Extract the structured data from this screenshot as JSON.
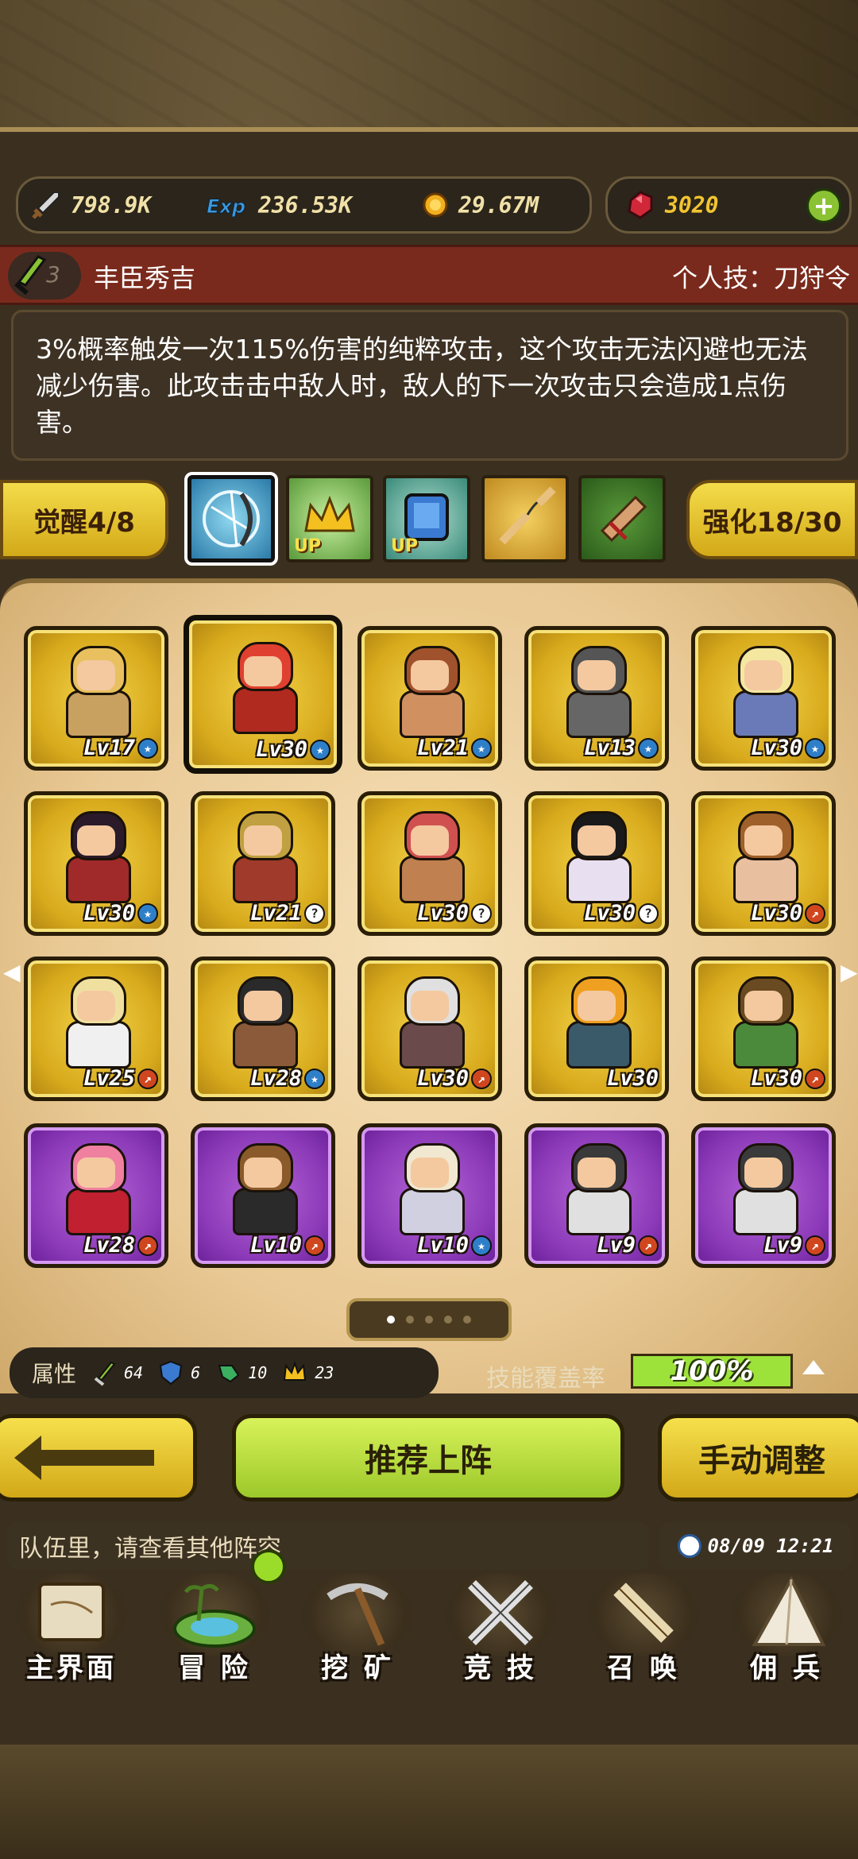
{
  "resources": {
    "attack": "798.9K",
    "exp": "236.53K",
    "gold": "29.67M",
    "gems": "3020"
  },
  "hero": {
    "level": "3",
    "name": "丰臣秀吉",
    "skill_label": "个人技：刀狩令",
    "description": "3%概率触发一次115%伤害的纯粹攻击，这个攻击无法闪避也无法减少伤害。此攻击击中敌人时，敌人的下一次攻击只会造成1点伤害。"
  },
  "tabs": {
    "awaken_label": "觉醒4/8",
    "enhance_label": "强化18/30",
    "up_label": "UP"
  },
  "roster": [
    {
      "level": "Lv17",
      "mark": "star",
      "rarity": "gold",
      "hair": "#e8c060",
      "outfit": "#c8a060"
    },
    {
      "level": "Lv30",
      "mark": "star",
      "rarity": "gold",
      "hair": "#e04030",
      "outfit": "#b02a20",
      "selected": true
    },
    {
      "level": "Lv21",
      "mark": "star",
      "rarity": "gold",
      "hair": "#a0522d",
      "outfit": "#d09060"
    },
    {
      "level": "Lv13",
      "mark": "star",
      "rarity": "gold",
      "hair": "#555555",
      "outfit": "#666666"
    },
    {
      "level": "Lv30",
      "mark": "star",
      "rarity": "gold",
      "hair": "#f4e8a0",
      "outfit": "#6a7ab8"
    },
    {
      "level": "Lv30",
      "mark": "star",
      "rarity": "gold",
      "hair": "#2a1a2a",
      "outfit": "#a02a2a"
    },
    {
      "level": "Lv21",
      "mark": "q",
      "rarity": "gold",
      "hair": "#c0a040",
      "outfit": "#a03a2a"
    },
    {
      "level": "Lv30",
      "mark": "q",
      "rarity": "gold",
      "hair": "#d05050",
      "outfit": "#c08050"
    },
    {
      "level": "Lv30",
      "mark": "q",
      "rarity": "gold",
      "hair": "#1a1a1a",
      "outfit": "#e8e0f0"
    },
    {
      "level": "Lv30",
      "mark": "bolt",
      "rarity": "gold",
      "hair": "#a0602a",
      "outfit": "#e8c0a0"
    },
    {
      "level": "Lv25",
      "mark": "bolt",
      "rarity": "gold",
      "hair": "#f0e0a0",
      "outfit": "#f0f0f0"
    },
    {
      "level": "Lv28",
      "mark": "star",
      "rarity": "gold",
      "hair": "#2a2a2a",
      "outfit": "#8a5a3a"
    },
    {
      "level": "Lv30",
      "mark": "bolt",
      "rarity": "gold",
      "hair": "#e0e0e0",
      "outfit": "#6a4a4a"
    },
    {
      "level": "Lv30",
      "mark": "",
      "rarity": "gold",
      "hair": "#f0a020",
      "outfit": "#3a5a6a"
    },
    {
      "level": "Lv30",
      "mark": "bolt",
      "rarity": "gold",
      "hair": "#6a4a20",
      "outfit": "#4a8a3a"
    },
    {
      "level": "Lv28",
      "mark": "bolt",
      "rarity": "purple",
      "hair": "#f080a0",
      "outfit": "#c02030"
    },
    {
      "level": "Lv10",
      "mark": "bolt",
      "rarity": "purple",
      "hair": "#8a5a2a",
      "outfit": "#2a2a2a"
    },
    {
      "level": "Lv10",
      "mark": "star",
      "rarity": "purple",
      "hair": "#f0e8d0",
      "outfit": "#d0d0e0"
    },
    {
      "level": "Lv9",
      "mark": "bolt",
      "rarity": "purple",
      "hair": "#3a3a3a",
      "outfit": "#e0e0e0"
    },
    {
      "level": "Lv9",
      "mark": "bolt",
      "rarity": "purple",
      "hair": "#3a3a3a",
      "outfit": "#e0e0e0"
    }
  ],
  "attributes": {
    "label": "属性",
    "attack": "64",
    "defense": "6",
    "agility": "10",
    "crown": "23",
    "coverage_label": "技能覆盖率",
    "coverage_value": "100%"
  },
  "actions": {
    "recommend": "推荐上阵",
    "manual": "手动调整"
  },
  "chat": {
    "message": "队伍里，请查看其他阵容",
    "time": "08/09 12:21"
  },
  "nav": [
    "主界面",
    "冒 险",
    "挖 矿",
    "竞 技",
    "召 唤",
    "佣 兵"
  ],
  "colors": {
    "gold_card": "#d8aa1c",
    "purple_card": "#8c3ab8",
    "recommend_button": "#9cc82a",
    "name_bar": "#7a2a1c"
  }
}
